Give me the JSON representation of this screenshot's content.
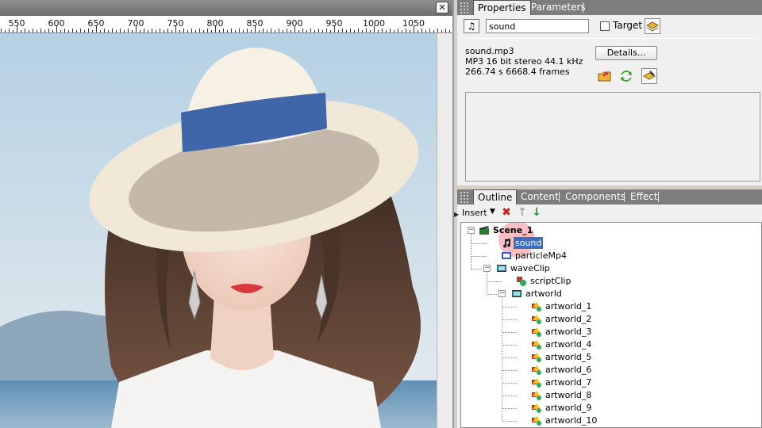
{
  "canvas": {
    "close_label": "✕",
    "ruler_ticks": [
      "550",
      "600",
      "650",
      "700",
      "750",
      "800",
      "850",
      "900",
      "950",
      "1000",
      "1050"
    ]
  },
  "properties": {
    "tabs": [
      "Properties",
      "Parameters"
    ],
    "name_value": "sound",
    "target_label": "Target",
    "target_checked": false,
    "file_name": "sound.mp3",
    "format_line": "MP3 16 bit stereo 44.1 kHz",
    "length_line": "266.74 s 6668.4 frames",
    "details_label": "Details..."
  },
  "outline": {
    "tabs": [
      "Outline",
      "Content",
      "Components",
      "Effect"
    ],
    "insert_label": "Insert",
    "tree": [
      {
        "label": "Scene_1",
        "bold": true,
        "level": 0,
        "icon": "scene-icon",
        "expander": "minus"
      },
      {
        "label": "sound",
        "selected": true,
        "level": 1,
        "icon": "music-note-icon"
      },
      {
        "label": "particleMp4",
        "level": 1,
        "icon": "video-icon"
      },
      {
        "label": "waveClip",
        "level": 1,
        "icon": "film-icon",
        "expander": "minus"
      },
      {
        "label": "scriptClip",
        "level": 2,
        "icon": "script-icon"
      },
      {
        "label": "artworld",
        "level": 2,
        "icon": "film-icon",
        "expander": "minus"
      },
      {
        "label": "artworld_1",
        "level": 3,
        "icon": "shapes-icon"
      },
      {
        "label": "artworld_2",
        "level": 3,
        "icon": "shapes-icon"
      },
      {
        "label": "artworld_3",
        "level": 3,
        "icon": "shapes-icon"
      },
      {
        "label": "artworld_4",
        "level": 3,
        "icon": "shapes-icon"
      },
      {
        "label": "artworld_5",
        "level": 3,
        "icon": "shapes-icon"
      },
      {
        "label": "artworld_6",
        "level": 3,
        "icon": "shapes-icon"
      },
      {
        "label": "artworld_7",
        "level": 3,
        "icon": "shapes-icon"
      },
      {
        "label": "artworld_8",
        "level": 3,
        "icon": "shapes-icon"
      },
      {
        "label": "artworld_9",
        "level": 3,
        "icon": "shapes-icon"
      },
      {
        "label": "artworld_10",
        "level": 3,
        "icon": "shapes-icon"
      }
    ]
  },
  "colors": {
    "selection": "#3a6fbf",
    "tabbar": "#7d7d7d",
    "panel": "#f0f0f0"
  }
}
